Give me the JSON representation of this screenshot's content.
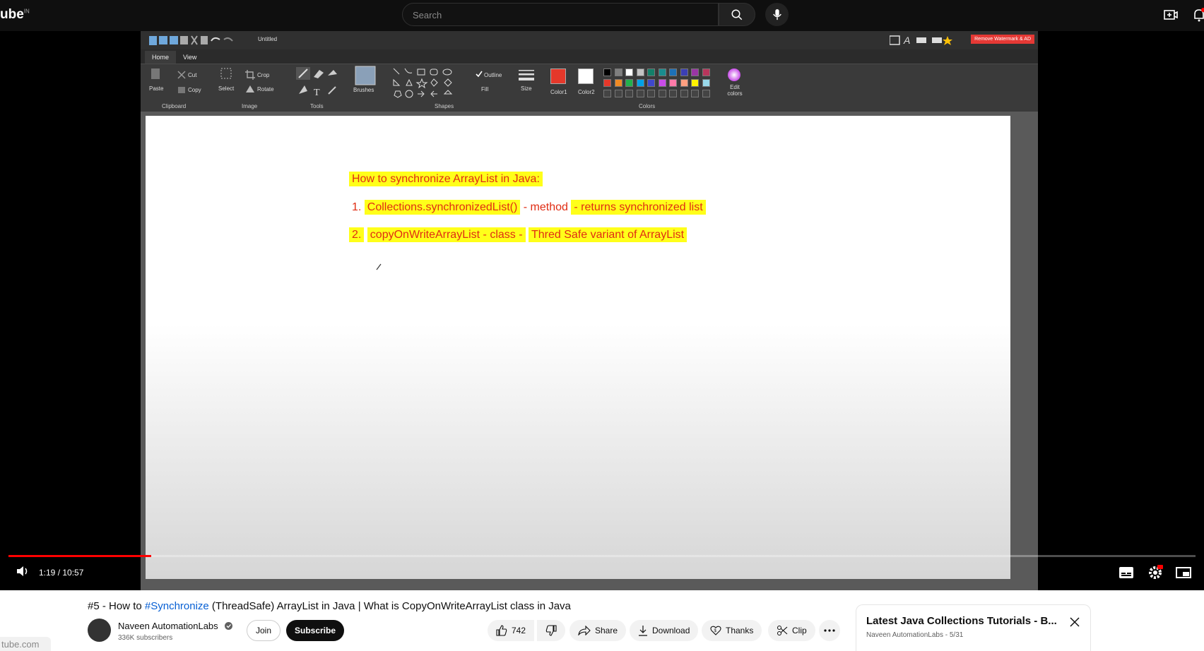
{
  "header": {
    "logo_text": "ube",
    "country": "IN",
    "search_placeholder": "Search"
  },
  "paint": {
    "document_title": "Untitled",
    "remove_watermark": "Remove Watermark & AD",
    "tabs": [
      "Home",
      "View"
    ],
    "ribbon": {
      "paste": "Paste",
      "cut": "Cut",
      "copy": "Copy",
      "select": "Select",
      "crop": "Crop",
      "rotate": "Rotate",
      "brushes": "Brushes",
      "outline": "Outline",
      "fill": "Fill",
      "size": "Size",
      "color1": "Color1",
      "color2": "Color2",
      "edit_colors": "Edit colors"
    },
    "groups": [
      "Clipboard",
      "Image",
      "Tools",
      "Shapes",
      "Colors"
    ],
    "palette": [
      "#000000",
      "#7f7f7f",
      "#ffffff",
      "#c3c3c3",
      "#138069",
      "#1a8d8f",
      "#1c71b8",
      "#3b3fb5",
      "#9a35a5",
      "#b8365c",
      "#e5382a",
      "#f08a24",
      "#22b14c",
      "#00a2e8",
      "#3f48cc",
      "#c84ce8",
      "#ff7aa8",
      "#ff9f80",
      "#fff200",
      "#99d9ea"
    ],
    "color1": "#e5382a",
    "color2": "#ffffff",
    "canvas_lines": {
      "line1": "How to synchronize ArrayList in Java:",
      "line2_num": "1.",
      "line2_a": "Collections.synchronizedList()",
      "line2_b": "- method",
      "line2_c": "- returns synchronized list",
      "line3_num": "2.",
      "line3_a": "copyOnWriteArrayList - class -",
      "line3_b": "Thred Safe variant of ArrayList"
    }
  },
  "player": {
    "time": "1:19 / 10:57",
    "progress": 0.12
  },
  "video": {
    "title_prefix": "#5 - How to ",
    "title_tag": "#Synchronize",
    "title_rest": " (ThreadSafe) ArrayList in Java | What is CopyOnWriteArrayList class in Java",
    "channel": "Naveen AutomationLabs",
    "subscribers": "336K subscribers",
    "join": "Join",
    "subscribe": "Subscribe",
    "likes": "742",
    "share": "Share",
    "download": "Download",
    "thanks": "Thanks",
    "clip": "Clip"
  },
  "playlist": {
    "title": "Latest Java Collections Tutorials - B...",
    "subtitle": "Naveen AutomationLabs - 5/31"
  },
  "status_url": "tube.com"
}
